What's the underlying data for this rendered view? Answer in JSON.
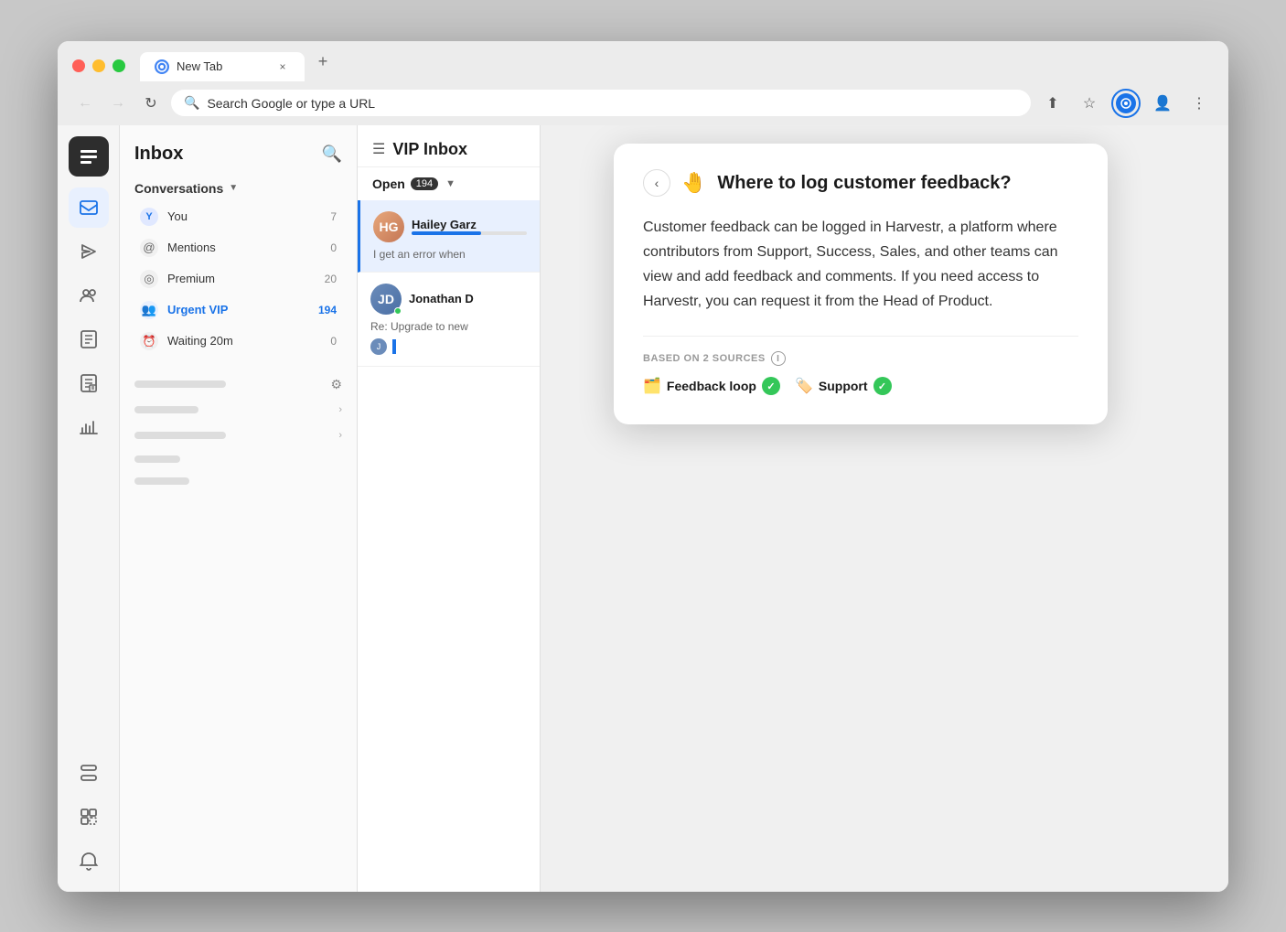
{
  "browser": {
    "tab_label": "New Tab",
    "address_bar_placeholder": "Search Google or type a URL",
    "new_tab_icon": "+",
    "close_tab_icon": "×"
  },
  "nav_panel": {
    "title": "Inbox",
    "conversations_label": "Conversations",
    "items": [
      {
        "id": "you",
        "label": "You",
        "count": "7",
        "icon": "👤"
      },
      {
        "id": "mentions",
        "label": "Mentions",
        "count": "0",
        "icon": "@"
      },
      {
        "id": "premium",
        "label": "Premium",
        "count": "20",
        "icon": "🔘"
      },
      {
        "id": "urgent-vip",
        "label": "Urgent VIP",
        "count": "194",
        "icon": "👥",
        "active": true
      },
      {
        "id": "waiting",
        "label": "Waiting 20m",
        "count": "0",
        "icon": "⏰"
      }
    ]
  },
  "inbox_panel": {
    "title": "VIP Inbox",
    "open_label": "Open",
    "open_count": "194",
    "conversations": [
      {
        "id": "hailey",
        "name": "Hailey Garz",
        "preview": "I get an error when",
        "avatar_initials": "HG",
        "has_progress": true,
        "selected": true
      },
      {
        "id": "jonathan",
        "name": "Jonathan D",
        "preview": "Re: Upgrade to new",
        "avatar_initials": "JD",
        "online": true,
        "selected": false
      }
    ]
  },
  "knowledge_popup": {
    "title": "Where to log customer feedback?",
    "title_icon": "🤚",
    "body": "Customer feedback can be logged in Harvestr, a platform where contributors from Support, Success, Sales, and other teams can view and add feedback and comments. If you need access to Harvestr, you can request it from the Head of Product.",
    "sources_label": "BASED ON 2 SOURCES",
    "sources": [
      {
        "id": "feedback-loop",
        "label": "Feedback loop",
        "icon": "🗂️"
      },
      {
        "id": "support",
        "label": "Support",
        "icon": "🏷️"
      }
    ],
    "back_icon": "‹"
  },
  "sidebar_icons": {
    "logo_text": "≡",
    "items": [
      {
        "id": "inbox",
        "icon": "✉",
        "active": true
      },
      {
        "id": "send",
        "icon": "✈"
      },
      {
        "id": "team",
        "icon": "👥"
      },
      {
        "id": "book",
        "icon": "📖"
      },
      {
        "id": "notes",
        "icon": "📋"
      },
      {
        "id": "chart",
        "icon": "📊"
      }
    ],
    "bottom_items": [
      {
        "id": "compose",
        "icon": "🖊"
      },
      {
        "id": "apps",
        "icon": "⊞"
      },
      {
        "id": "bell",
        "icon": "🔔"
      }
    ]
  }
}
